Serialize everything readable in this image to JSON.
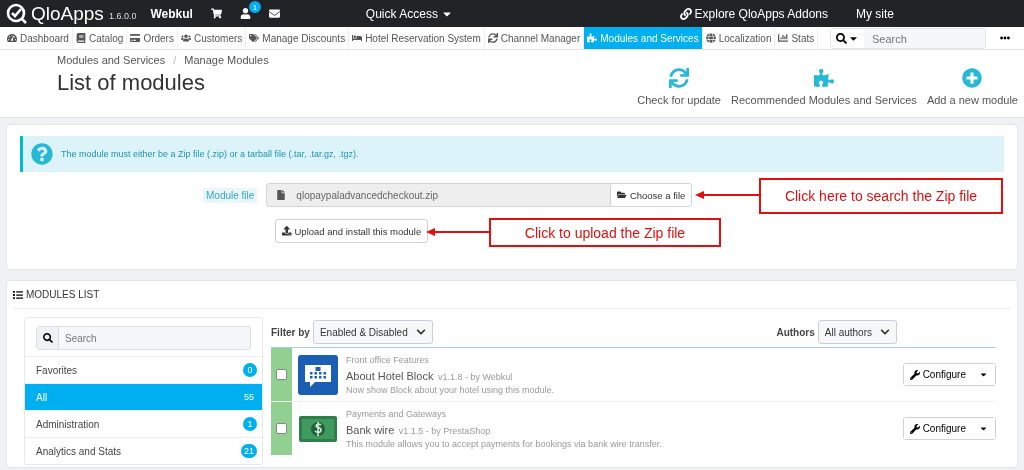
{
  "topbar": {
    "brand": "QloApps",
    "version": "1.6.0.0",
    "shop": "Webkul",
    "notification_count": "1",
    "quick_access": "Quick Access",
    "addons_link": "Explore QloApps Addons",
    "my_site": "My site"
  },
  "nav": [
    {
      "label": "Dashboard",
      "selected": false
    },
    {
      "label": "Catalog",
      "selected": false
    },
    {
      "label": "Orders",
      "selected": false
    },
    {
      "label": "Customers",
      "selected": false
    },
    {
      "label": "Manage Discounts",
      "selected": false
    },
    {
      "label": "Hotel Reservation System",
      "selected": false
    },
    {
      "label": "Channel Manager",
      "selected": false
    },
    {
      "label": "Modules and Services",
      "selected": true
    },
    {
      "label": "Localization",
      "selected": false
    },
    {
      "label": "Stats",
      "selected": false
    }
  ],
  "nav_search": {
    "placeholder": "Search"
  },
  "breadcrumb": [
    "Modules and Services",
    "Manage Modules"
  ],
  "breadcrumb_separator": "/",
  "page_title": "List of modules",
  "toolbar": [
    "Check for update",
    "Recommended Modules and Services",
    "Add a new module"
  ],
  "upload": {
    "info": "The module must either be a Zip file (.zip) or a tarball file (.tar, .tar.gz, .tgz).",
    "file_label": "Module file",
    "file_value": "qlopaypaladvancedcheckout.zip",
    "choose_button": "Choose a file",
    "upload_button": "Upload and install this module"
  },
  "annotations": [
    "Click here to search the Zip file",
    "Click to upload the Zip file"
  ],
  "modules_list": {
    "title": "MODULES LIST",
    "search": {
      "placeholder": "Search"
    },
    "categories": [
      {
        "label": "Favorites",
        "count": "0",
        "selected": false
      },
      {
        "label": "All",
        "count": "55",
        "selected": true
      },
      {
        "label": "Administration",
        "count": "1",
        "selected": false
      },
      {
        "label": "Analytics and Stats",
        "count": "21",
        "selected": false
      }
    ],
    "filter_label": "Filter by",
    "filter_value": "Enabled & Disabled",
    "authors_label": "Authors",
    "authors_value": "All authors",
    "modules": [
      {
        "category": "Front office Features",
        "name": "About Hotel Block",
        "version": "v1.1.8 - by Webkul",
        "description": "Now show Block about your hotel using this module.",
        "enabled": true,
        "checked": false,
        "action": "Configure"
      },
      {
        "category": "Payments and Gateways",
        "name": "Bank wire",
        "version": "v1.1.5 - by PrestaShop",
        "description": "This module allows you to accept payments for bookings via bank wire transfer.",
        "enabled": true,
        "checked": false,
        "action": "Configure"
      }
    ]
  }
}
